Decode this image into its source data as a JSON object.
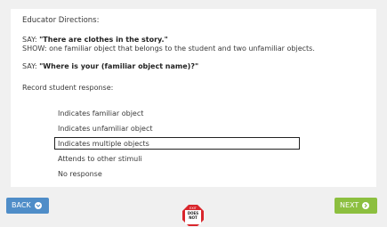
{
  "directions": {
    "title": "Educator Directions:",
    "say1_prefix": "SAY: ",
    "say1_quote": "\"There are clothes in the story.\"",
    "show_text": "SHOW: one familiar object that belongs to the student and two unfamiliar objects.",
    "say2_prefix": "SAY: ",
    "say2_quote": "\"Where is your (familiar object name)?\"",
    "record": "Record student response:"
  },
  "options": [
    {
      "label": "Indicates familiar object",
      "selected": false
    },
    {
      "label": "Indicates unfamiliar object",
      "selected": false
    },
    {
      "label": "Indicates multiple objects",
      "selected": true
    },
    {
      "label": "Attends to other stimuli",
      "selected": false
    },
    {
      "label": "No response",
      "selected": false
    }
  ],
  "buttons": {
    "back": "BACK",
    "next": "NEXT"
  },
  "exit": {
    "line1": "EXIT",
    "line2": "DOES",
    "line3": "NOT"
  },
  "colors": {
    "back": "#4f8dc8",
    "next": "#8cbf3f",
    "stop": "#d9262c"
  }
}
